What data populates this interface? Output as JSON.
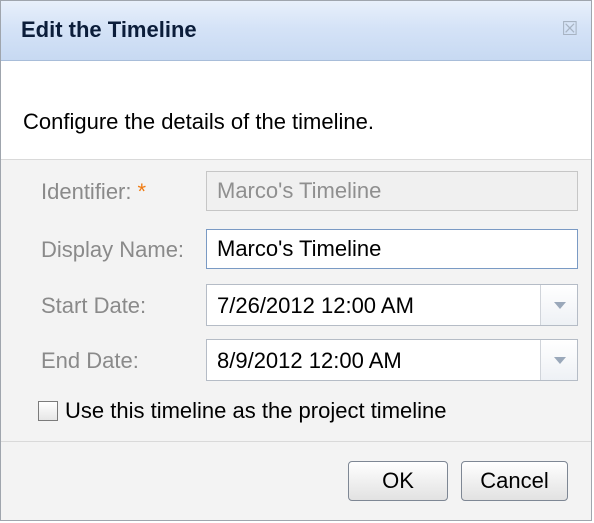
{
  "dialog": {
    "title": "Edit the Timeline",
    "close_icon": "close-icon",
    "description": "Configure the details of the timeline."
  },
  "form": {
    "identifier": {
      "label": "Identifier:",
      "required_marker": "*",
      "value": "Marco's Timeline"
    },
    "display_name": {
      "label": "Display Name:",
      "value": "Marco's Timeline"
    },
    "start_date": {
      "label": "Start Date:",
      "value": "7/26/2012 12:00 AM",
      "dropdown_icon": "chevron-down-icon"
    },
    "end_date": {
      "label": "End Date:",
      "value": "8/9/2012 12:00 AM",
      "dropdown_icon": "chevron-down-icon"
    },
    "project_timeline_checkbox": {
      "label": "Use this timeline as the project timeline",
      "checked": false
    }
  },
  "buttons": {
    "ok": "OK",
    "cancel": "Cancel"
  },
  "colors": {
    "title_gradient_top": "#e8f0fb",
    "title_gradient_bottom": "#c7d9f2",
    "required_star": "#f07a10",
    "disabled_text": "#8f8f8f",
    "label_text": "#8a8a8a"
  }
}
